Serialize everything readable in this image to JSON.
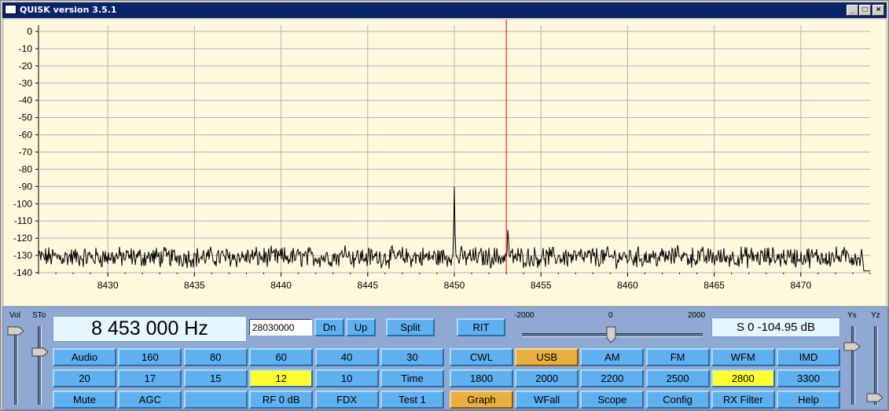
{
  "window": {
    "title": "QUISK version 3.5.1"
  },
  "titlebar_buttons": {
    "minimize": "_",
    "maximize": "□",
    "close": "×"
  },
  "graph": {
    "y_ticks": [
      "0",
      "-10",
      "-20",
      "-30",
      "-40",
      "-50",
      "-60",
      "-70",
      "-80",
      "-90",
      "-100",
      "-110",
      "-120",
      "-130",
      "-140"
    ],
    "x_ticks": [
      "8430",
      "8435",
      "8440",
      "8445",
      "8450",
      "8455",
      "8460",
      "8465",
      "8470"
    ],
    "colors": {
      "background": "#fff8dc",
      "trace": "#000000",
      "tuning_line": "#ff0000",
      "grid": "#b4b4b4"
    },
    "chart_data": {
      "type": "line",
      "xlabel": "",
      "ylabel": "",
      "xlim": [
        8426,
        8474
      ],
      "ylim": [
        -140,
        0
      ],
      "noise_floor_db": -131,
      "tuning_line_khz": 8453,
      "peaks": [
        {
          "x": 8450,
          "y": -90
        },
        {
          "x": 8453.1,
          "y": -113
        },
        {
          "x": 8443.7,
          "y": -124
        },
        {
          "x": 8462.9,
          "y": -123
        }
      ]
    }
  },
  "controls": {
    "vol_label": "Vol",
    "sto_label": "STo",
    "ys_label": "Ys",
    "yz_label": "Yz",
    "frequency_display": "8 453 000 Hz",
    "frequency_entry": "28030000",
    "dn_button": "Dn",
    "up_button": "Up",
    "split_button": "Split",
    "rit_button": "RIT",
    "rit_scale": {
      "min": "-2000",
      "mid": "0",
      "max": "2000"
    },
    "smeter": "S 0   -104.95 dB",
    "band_buttons": [
      [
        "Audio",
        "160",
        "80",
        "60",
        "40",
        "30"
      ],
      [
        "20",
        "17",
        "15",
        "12",
        "10",
        "Time"
      ],
      [
        "Mute",
        "AGC",
        "",
        "RF 0 dB",
        "FDX",
        "Test 1"
      ]
    ],
    "mode_buttons": [
      [
        "CWL",
        "USB",
        "AM",
        "FM",
        "WFM",
        "IMD"
      ],
      [
        "1800",
        "2000",
        "2200",
        "2500",
        "2800",
        "3300"
      ],
      [
        "Graph",
        "WFall",
        "Scope",
        "Config",
        "RX Filter",
        "Help"
      ]
    ],
    "highlight": {
      "band_selected": "12",
      "mode_selected": "USB",
      "filter_selected": "2800",
      "view_selected": "Graph"
    }
  }
}
